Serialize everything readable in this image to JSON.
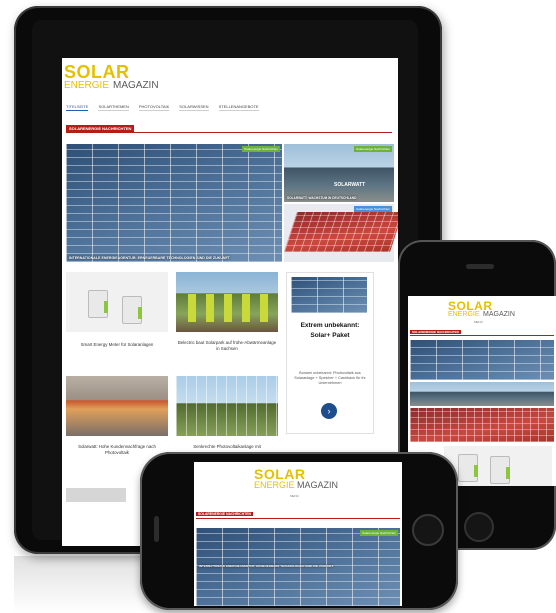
{
  "site": {
    "logo_solar": "SOLAR",
    "logo_energie": "ENERGIE",
    "logo_magazin": "MAGAZIN"
  },
  "nav": [
    "TITELSEITE",
    "SOLARTHEMEN",
    "PHOTOVOLTAIK",
    "SOLARWISSEN",
    "STELLENANGEBOTE"
  ],
  "section_label": "SOLARENERGIE NACHRICHTEN",
  "featured": {
    "badge": "Solarenergie Nachrichten",
    "caption": "INTERNATIONALE ENERGIEAGENTUR: ERNEUERBARE TECHNOLOGIEN SIND DIE ZUKUNFT"
  },
  "side_articles": [
    {
      "badge": "Solarenergie Nachrichten",
      "brand": "SOLARWATT",
      "caption": "SOLARWATT: WACHSTUM IN DEUTSCHLAND"
    },
    {
      "badge": "Solarenergie Nachrichten"
    }
  ],
  "cards": [
    {
      "caption": "Smart Energy Meter für Solaranlagen"
    },
    {
      "caption": "Belectric baut Solarpark auf frühe-Abwärmeanlage in Sachsen"
    },
    {
      "caption": "Solarwatt: Hohe Kundennachfrage nach Photovoltaik"
    },
    {
      "caption": "Senkrechte Photovoltaikanlage mit"
    }
  ],
  "ad": {
    "title_line1": "Extrem unbekannt:",
    "title_line2": "Solar+ Paket",
    "text": "Bonami unbekannt: Photovoltaik aus Solaranlage + Speicher + Cashback für ihr Unternehmen",
    "button": "›"
  },
  "menu_label": "MENÜ"
}
